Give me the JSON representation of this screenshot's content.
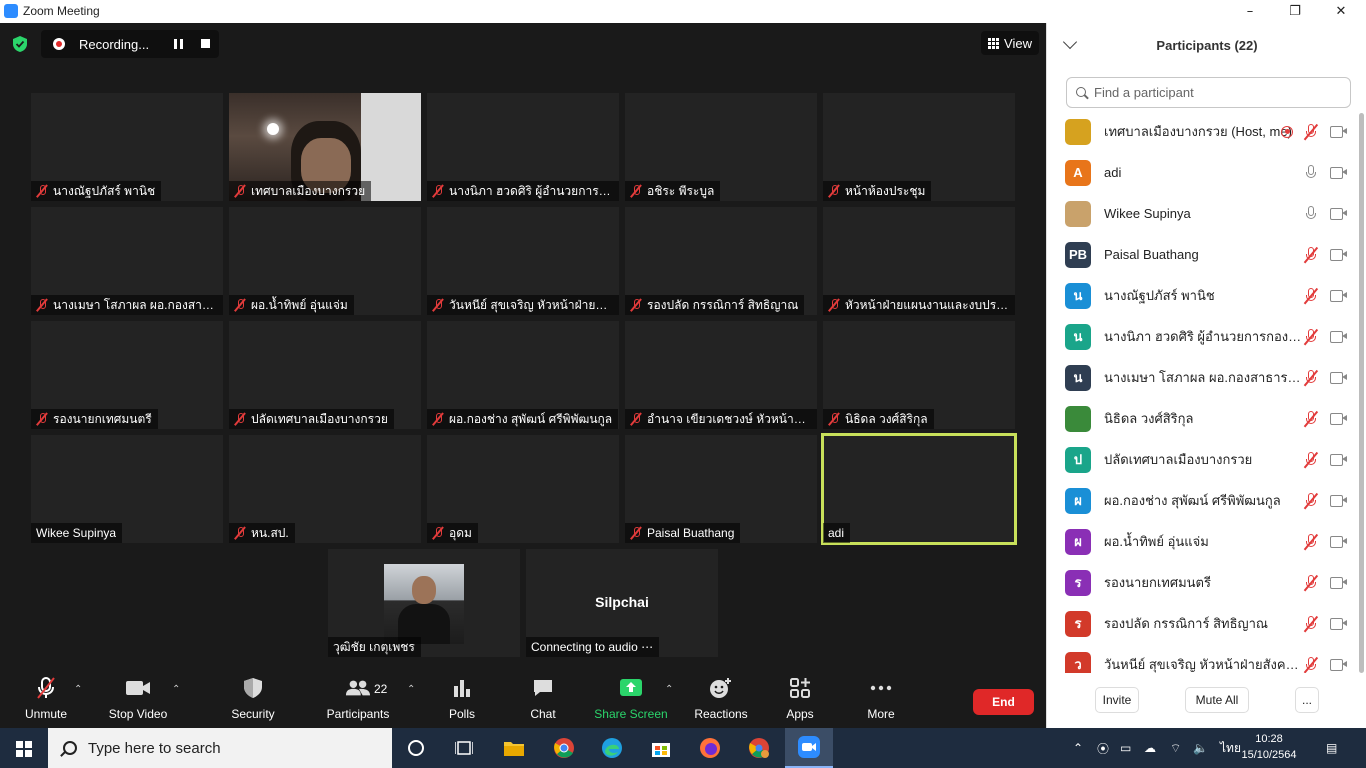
{
  "window": {
    "title": "Zoom Meeting",
    "minimize": "–",
    "restore": "❐",
    "close": "✕"
  },
  "recording": {
    "label": "Recording..."
  },
  "view_button": {
    "label": "View"
  },
  "tiles": [
    {
      "name": "นางณัฐปภัสร์ พานิช",
      "muted": true
    },
    {
      "name": "เทศบาลเมืองบางกรวย",
      "muted": true,
      "video": true
    },
    {
      "name": "นางนิภา ฮวดศิริ  ผู้อำนวยการก...",
      "muted": true
    },
    {
      "name": "อชิระ พีระบูล",
      "muted": true
    },
    {
      "name": "หน้าห้องประชุม",
      "muted": true
    },
    {
      "name": "นางเมษา  โสภาผล ผอ.กองสาธ...",
      "muted": true
    },
    {
      "name": "ผอ.น้ำทิพย์ อุ่นแจ่ม",
      "muted": true
    },
    {
      "name": "วันหนีย์ สุขเจริญ หัวหน้าฝ่ายสัง...",
      "muted": true
    },
    {
      "name": "รองปลัด กรรณิการ์  สิทธิญาณ",
      "muted": true
    },
    {
      "name": "หัวหน้าฝ่ายแผนงานและงบประมา...",
      "muted": true
    },
    {
      "name": "รองนายกเทศมนตรี",
      "muted": true
    },
    {
      "name": "ปลัดเทศบาลเมืองบางกรวย",
      "muted": true
    },
    {
      "name": "ผอ.กองช่าง สุพัฒน์ ศรีพิพัฒนกูล",
      "muted": true
    },
    {
      "name": "อำนาจ เขียวเดชวงษ์ หัวหน้าฝ่า...",
      "muted": true
    },
    {
      "name": "นิธิดล วงศ์สิริกุล",
      "muted": true
    },
    {
      "name": "Wikee Supinya",
      "muted": false
    },
    {
      "name": "หน.สป.",
      "muted": true
    },
    {
      "name": "อุดม",
      "muted": true
    },
    {
      "name": "Paisal Buathang",
      "muted": true
    },
    {
      "name": "adi",
      "muted": false,
      "active": true
    },
    {
      "name": "วุฒิชัย เกตุเพชร",
      "muted": false,
      "photo": true
    },
    {
      "name": "Connecting to audio ⋯",
      "muted": false,
      "center_label": "Silpchai"
    }
  ],
  "toolbar": {
    "unmute": "Unmute",
    "stop_video": "Stop Video",
    "security": "Security",
    "participants": "Participants",
    "participants_count": "22",
    "polls": "Polls",
    "chat": "Chat",
    "share_screen": "Share Screen",
    "reactions": "Reactions",
    "apps": "Apps",
    "more": "More",
    "end": "End"
  },
  "panel": {
    "title": "Participants (22)",
    "search_placeholder": "Find a participant",
    "invite": "Invite",
    "mute_all": "Mute All",
    "more": "..."
  },
  "participants": [
    {
      "name": "เทศบาลเมืองบางกรวย (Host, me)",
      "avatar": "",
      "color": "#d6a21f",
      "mic": "muted",
      "recording": true
    },
    {
      "name": "adi",
      "avatar": "A",
      "color": "#e8751a",
      "mic": "on"
    },
    {
      "name": "Wikee Supinya",
      "avatar": "",
      "color": "#c9a26b",
      "mic": "on"
    },
    {
      "name": "Paisal Buathang",
      "avatar": "PB",
      "color": "#2f3e52",
      "mic": "muted"
    },
    {
      "name": "นางณัฐปภัสร์ พานิช",
      "avatar": "น",
      "color": "#1a8fd6",
      "mic": "muted"
    },
    {
      "name": "นางนิภา ฮวดศิริ  ผู้อำนวยการกองคลัง",
      "avatar": "น",
      "color": "#1aa58a",
      "mic": "muted"
    },
    {
      "name": "นางเมษา  โสภาผล ผอ.กองสาธารณสุ...",
      "avatar": "น",
      "color": "#2f3e52",
      "mic": "muted"
    },
    {
      "name": "นิธิดล วงศ์สิริกุล",
      "avatar": "",
      "color": "#3a8a3a",
      "mic": "muted"
    },
    {
      "name": "ปลัดเทศบาลเมืองบางกรวย",
      "avatar": "ป",
      "color": "#1aa58a",
      "mic": "muted"
    },
    {
      "name": "ผอ.กองช่าง สุพัฒน์ ศรีพิพัฒนกูล",
      "avatar": "ผ",
      "color": "#1a8fd6",
      "mic": "muted"
    },
    {
      "name": "ผอ.น้ำทิพย์ อุ่นแจ่ม",
      "avatar": "ผ",
      "color": "#8a2fb5",
      "mic": "muted"
    },
    {
      "name": "รองนายกเทศมนตรี",
      "avatar": "ร",
      "color": "#8a2fb5",
      "mic": "muted"
    },
    {
      "name": "รองปลัด กรรณิการ์  สิทธิญาณ",
      "avatar": "ร",
      "color": "#d23a2a",
      "mic": "muted"
    },
    {
      "name": "วันหนีย์ สุขเจริญ หัวหน้าฝ่ายสังคมสง...",
      "avatar": "ว",
      "color": "#d23a2a",
      "mic": "muted"
    }
  ],
  "taskbar": {
    "search_placeholder": "Type here to search",
    "language": "ไทย",
    "time": "10:28",
    "date": "15/10/2564"
  },
  "colors": {
    "accent_green": "#2bd56b",
    "end_red": "#e02828",
    "active_border": "#c8e05a"
  }
}
